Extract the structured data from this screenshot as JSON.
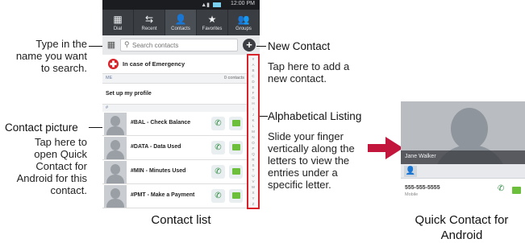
{
  "phone": {
    "status_time": "12:00 PM",
    "tabs": [
      {
        "label": "Dial",
        "icon": "dialpad-icon"
      },
      {
        "label": "Recent",
        "icon": "recent-calls-icon"
      },
      {
        "label": "Contacts",
        "icon": "contacts-icon"
      },
      {
        "label": "Favorites",
        "icon": "star-icon"
      },
      {
        "label": "Groups",
        "icon": "groups-icon"
      }
    ],
    "search_placeholder": "Search contacts",
    "ice_label": "In case of Emergency",
    "ice_sub_left": "ME",
    "ice_sub_right": "0 contacts",
    "profile_label": "Set up my profile",
    "section_letter": "#",
    "contacts": [
      {
        "name": "#BAL - Check Balance"
      },
      {
        "name": "#DATA - Data Used"
      },
      {
        "name": "#MIN - Minutes Used"
      },
      {
        "name": "#PMT - Make a Payment"
      }
    ],
    "alphabet": [
      "#",
      "A",
      "B",
      "C",
      "D",
      "E",
      "F",
      "G",
      "H",
      "I",
      "J",
      "K",
      "L",
      "M",
      "N",
      "O",
      "P",
      "Q",
      "R",
      "S",
      "T",
      "U",
      "V",
      "W",
      "X",
      "Y",
      "Z"
    ]
  },
  "annotations": {
    "search": [
      "Type in the",
      "name you want",
      "to search."
    ],
    "picture_title": "Contact picture",
    "picture_desc": [
      "Tap here to",
      "open Quick",
      "Contact for",
      "Android for this",
      "contact."
    ],
    "new_contact_title": "New Contact",
    "new_contact_desc": [
      "Tap here to add a",
      "new contact."
    ],
    "alpha_title": "Alphabetical Listing",
    "alpha_desc": [
      "Slide your finger",
      "vertically along the",
      "letters to view the",
      "entries under a",
      "specific letter."
    ]
  },
  "captions": {
    "contact_list": "Contact list",
    "quick_contact": [
      "Quick Contact for",
      "Android"
    ]
  },
  "quick_contact": {
    "name": "Jane Walker",
    "number": "555-555-5555",
    "type": "Mobile"
  },
  "colors": {
    "highlight": "#d8232a",
    "arrow": "#c3163d",
    "call": "#2b8a3e",
    "message": "#6cbf3a"
  }
}
